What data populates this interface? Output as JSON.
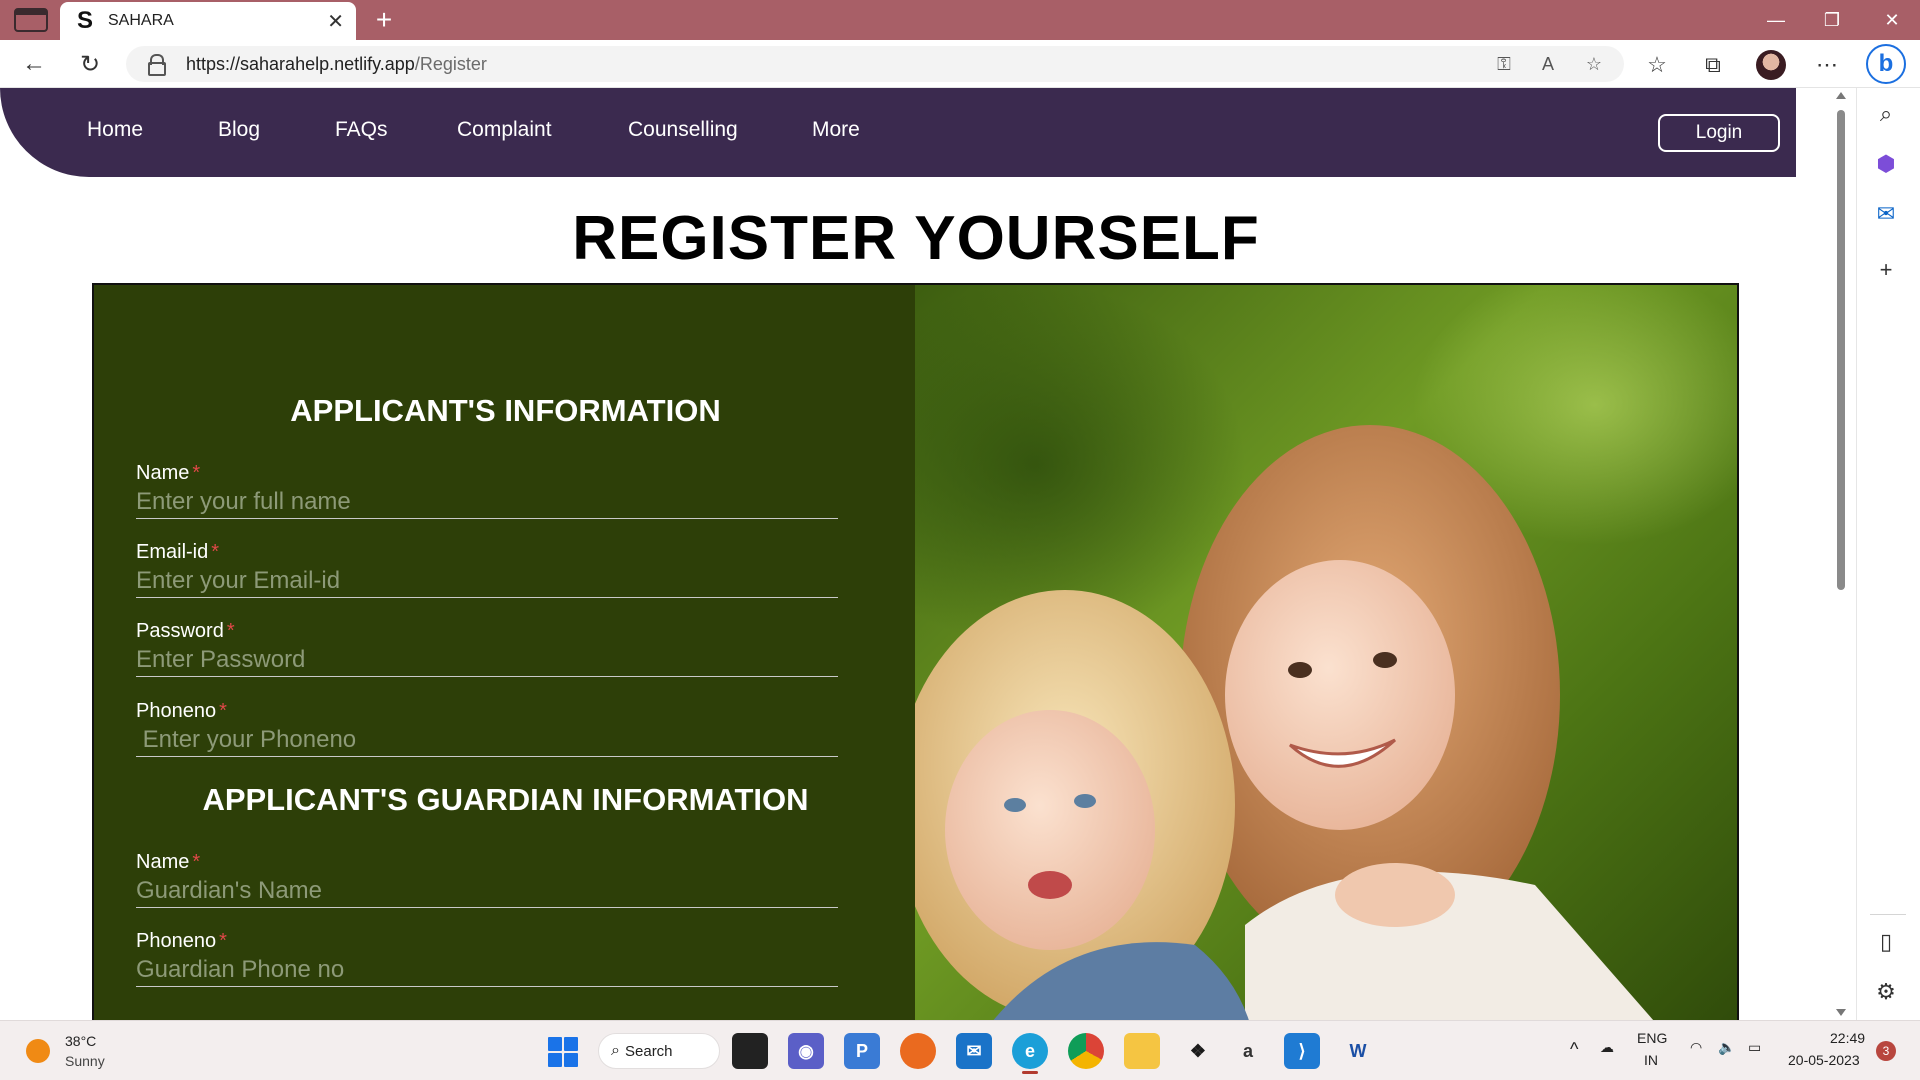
{
  "browser": {
    "tab_title": "SAHARA",
    "tab_favicon": "S",
    "url_host": "https://saharahelp.netlify.app",
    "url_path": "/Register",
    "bing_label": "b"
  },
  "site": {
    "nav": [
      "Home",
      "Blog",
      "FAQs",
      "Complaint",
      "Counselling",
      "More"
    ],
    "login_label": "Login",
    "page_title": "REGISTER YOURSELF",
    "colors": {
      "nav_bg": "#3b2a4f",
      "form_bg": "#2d3f08",
      "required": "#e04848"
    }
  },
  "form": {
    "applicant_title": "APPLICANT'S INFORMATION",
    "guardian_title": "APPLICANT'S GUARDIAN INFORMATION",
    "required_mark": "*",
    "fields": [
      {
        "label": "Name",
        "placeholder": "Enter your full name"
      },
      {
        "label": "Email-id",
        "placeholder": "Enter your Email-id"
      },
      {
        "label": "Password",
        "placeholder": "Enter Password"
      },
      {
        "label": "Phoneno",
        "placeholder": " Enter your Phoneno"
      }
    ],
    "guardian_fields": [
      {
        "label": "Name",
        "placeholder": "Guardian's Name"
      },
      {
        "label": "Phoneno",
        "placeholder": "Guardian Phone no"
      }
    ]
  },
  "taskbar": {
    "weather_temp": "38°C",
    "weather_cond": "Sunny",
    "search_label": "Search",
    "lang_top": "ENG",
    "lang_bottom": "IN",
    "time": "22:49",
    "date": "20-05-2023",
    "notifications": "3"
  }
}
